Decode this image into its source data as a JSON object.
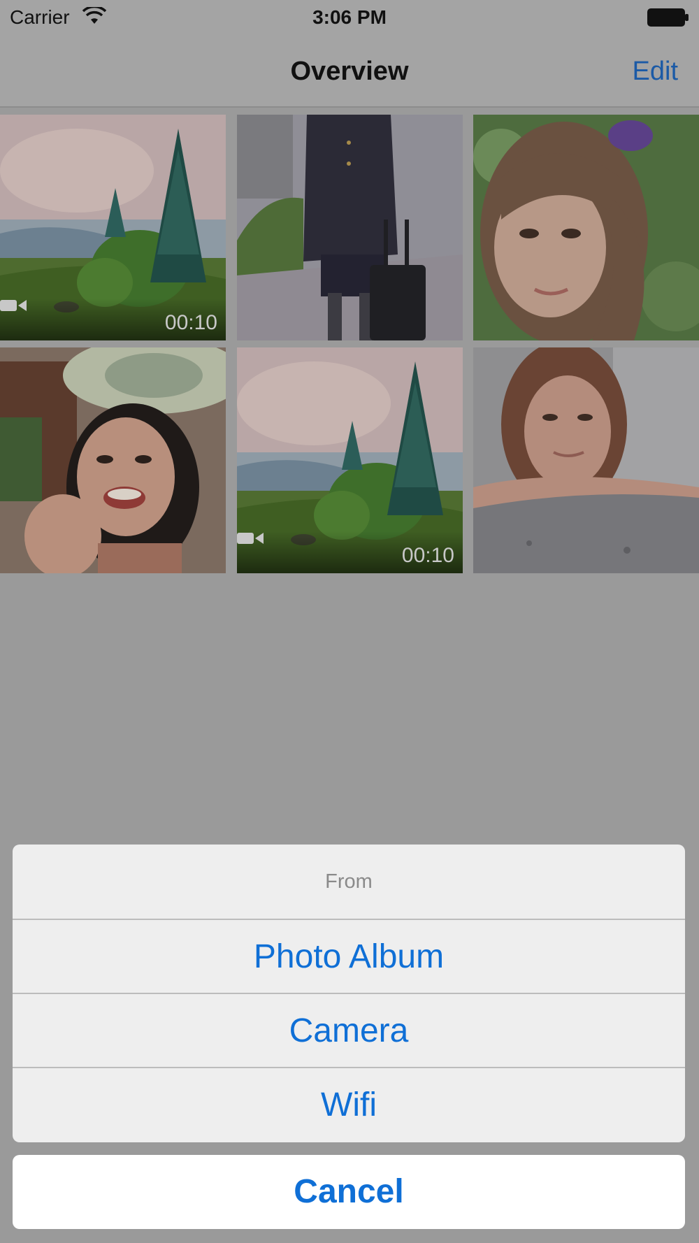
{
  "status_bar": {
    "carrier": "Carrier",
    "time": "3:06 PM",
    "icons": [
      "wifi-icon",
      "battery-icon"
    ]
  },
  "nav": {
    "title": "Overview",
    "edit_label": "Edit"
  },
  "grid": {
    "items": [
      {
        "kind": "video",
        "subject": "landscape with pine trees",
        "duration": "00:10"
      },
      {
        "kind": "photo",
        "subject": "woman in uniform with suitcase"
      },
      {
        "kind": "photo",
        "subject": "portrait with purple bow"
      },
      {
        "kind": "photo",
        "subject": "smiling woman with white hat"
      },
      {
        "kind": "video",
        "subject": "landscape with pine trees",
        "duration": "00:10"
      },
      {
        "kind": "photo",
        "subject": "woman leaning on rock"
      }
    ]
  },
  "action_sheet": {
    "title": "From",
    "options": [
      "Photo Album",
      "Camera",
      "Wifi"
    ],
    "cancel_label": "Cancel"
  },
  "colors": {
    "accent": "#0f6fd6",
    "dim_overlay": "#9a9a9a"
  }
}
